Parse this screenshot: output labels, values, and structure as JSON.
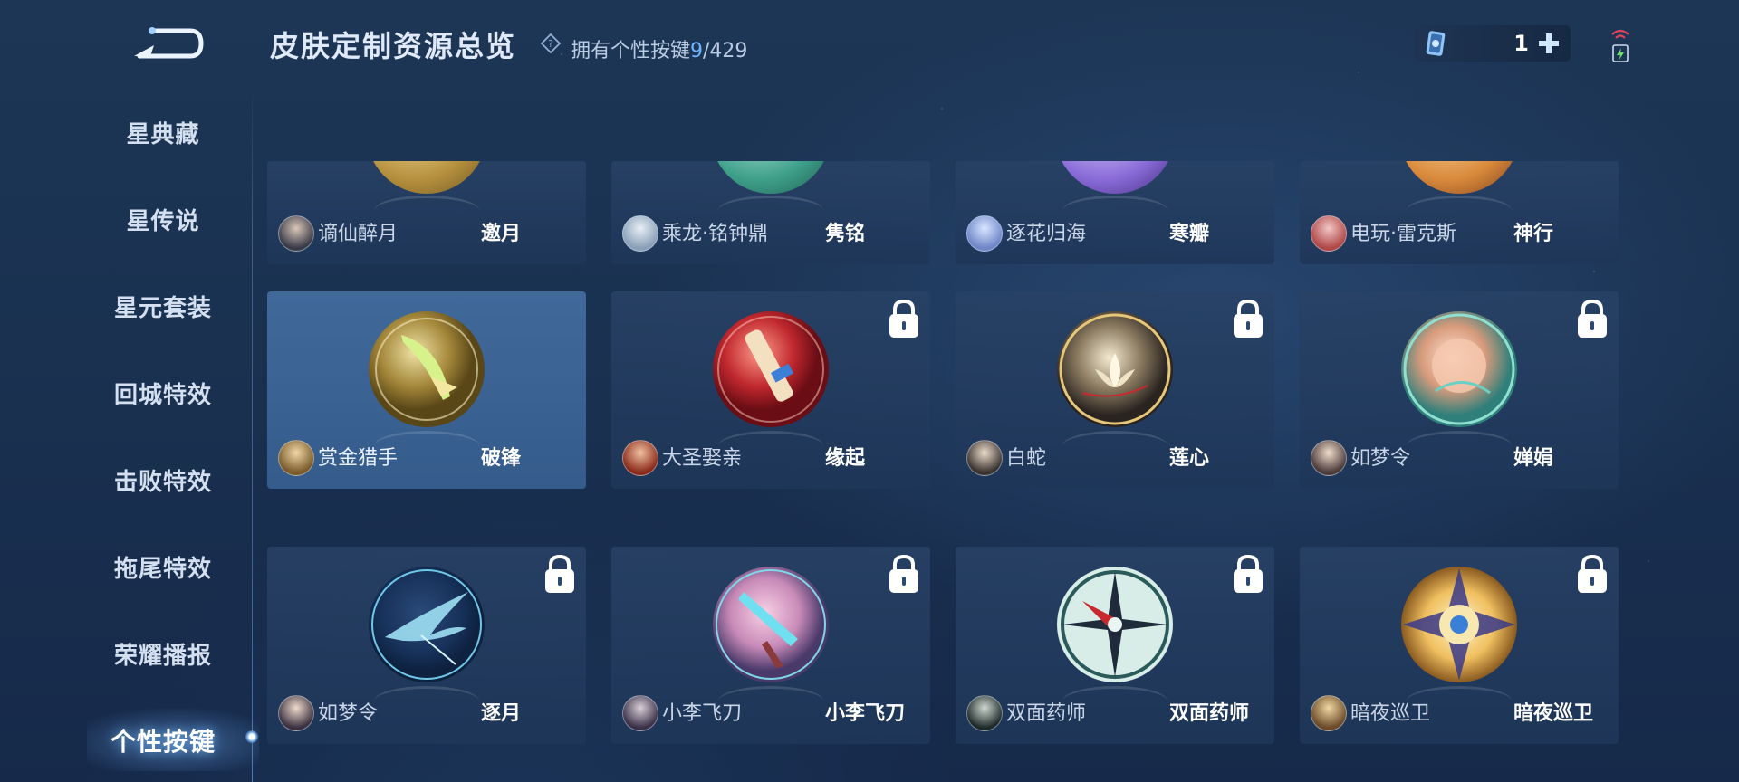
{
  "header": {
    "title": "皮肤定制资源总览",
    "owned_prefix": "拥有个性按键",
    "owned_count": "9",
    "owned_total": "/429",
    "currency_count": "1"
  },
  "sidebar": {
    "items": [
      {
        "label": "星典藏"
      },
      {
        "label": "星传说"
      },
      {
        "label": "星元套装"
      },
      {
        "label": "回城特效"
      },
      {
        "label": "击败特效"
      },
      {
        "label": "拖尾特效"
      },
      {
        "label": "荣耀播报"
      },
      {
        "label": "个性按键",
        "active": true
      }
    ]
  },
  "cards": [
    {
      "hero": "谪仙醉月",
      "skin": "邀月",
      "locked": false,
      "medal": "gold"
    },
    {
      "hero": "乘龙·铭钟鼎",
      "skin": "隽铭",
      "locked": false,
      "medal": "teal"
    },
    {
      "hero": "逐花归海",
      "skin": "寒瓣",
      "locked": false,
      "medal": "purple"
    },
    {
      "hero": "电玩·雷克斯",
      "skin": "神行",
      "locked": false,
      "medal": "orange"
    },
    {
      "hero": "赏金猎手",
      "skin": "破锋",
      "locked": false,
      "medal": "gold-blade"
    },
    {
      "hero": "大圣娶亲",
      "skin": "缘起",
      "locked": true,
      "medal": "red-scroll"
    },
    {
      "hero": "白蛇",
      "skin": "莲心",
      "locked": true,
      "medal": "lotus"
    },
    {
      "hero": "如梦令",
      "skin": "婵娟",
      "locked": true,
      "medal": "moon"
    },
    {
      "hero": "如梦令",
      "skin": "逐月",
      "locked": true,
      "medal": "phoenix"
    },
    {
      "hero": "小李飞刀",
      "skin": "小李飞刀",
      "locked": true,
      "medal": "blade"
    },
    {
      "hero": "双面药师",
      "skin": "双面药师",
      "locked": true,
      "medal": "compass"
    },
    {
      "hero": "暗夜巡卫",
      "skin": "暗夜巡卫",
      "locked": true,
      "medal": "star-eye"
    }
  ],
  "colors": {
    "accent": "#6fb4ff",
    "card_bg": "#2a4a72",
    "card_selected_bg": "#42699c"
  }
}
